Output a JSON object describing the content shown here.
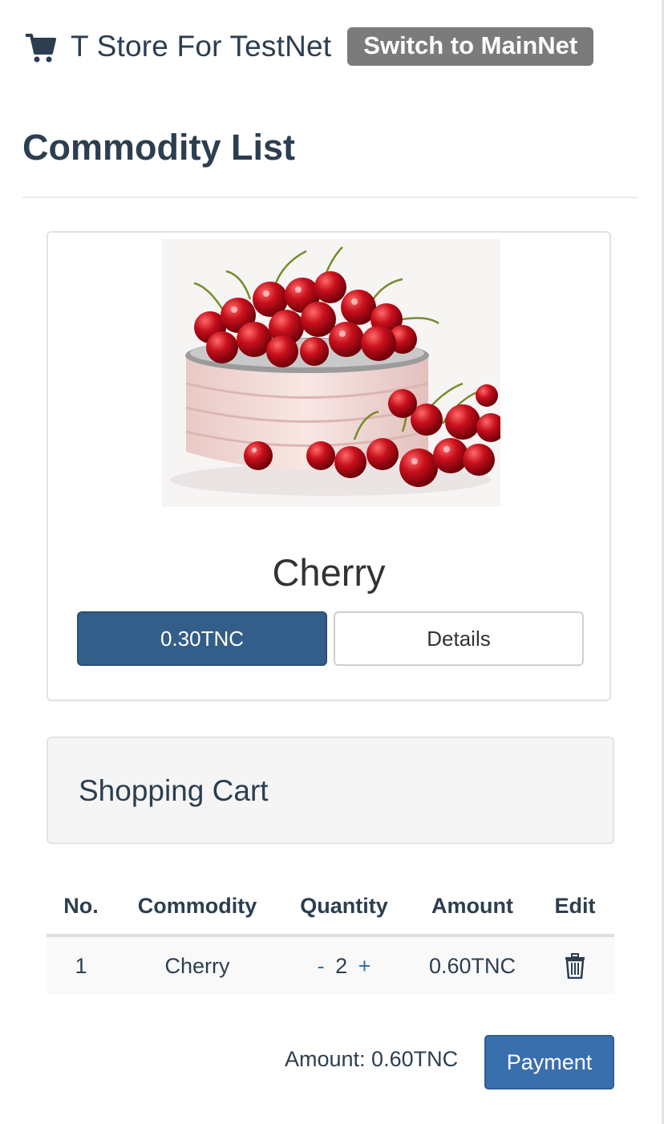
{
  "header": {
    "store_title": "T Store For TestNet",
    "switch_label": "Switch to MainNet"
  },
  "page_title": "Commodity List",
  "product": {
    "name": "Cherry",
    "price_label": "0.30TNC",
    "details_label": "Details",
    "image_icon": "cherries-in-bowl-image"
  },
  "cart": {
    "heading": "Shopping Cart",
    "columns": [
      "No.",
      "Commodity",
      "Quantity",
      "Amount",
      "Edit"
    ],
    "rows": [
      {
        "no": "1",
        "commodity": "Cherry",
        "minus": "-",
        "quantity": "2",
        "plus": "+",
        "amount": "0.60TNC",
        "edit_icon": "trash-icon"
      }
    ]
  },
  "footer": {
    "amount_label": "Amount: 0.60TNC",
    "payment_label": "Payment"
  },
  "colors": {
    "primary": "#345e8a",
    "payment": "#3a6fad",
    "switch_bg": "#7b7b7b",
    "text": "#2c3e50",
    "link": "#2f6fa8"
  }
}
